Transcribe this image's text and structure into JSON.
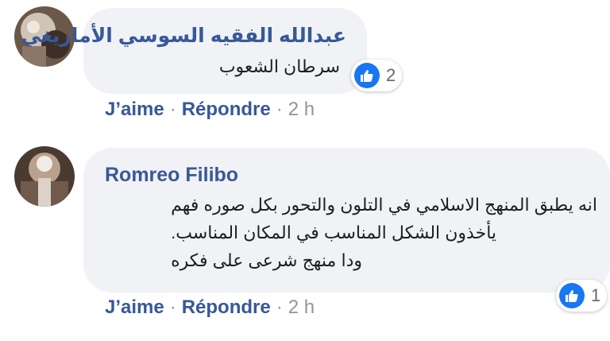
{
  "comments": [
    {
      "author": "عبدالله الفقيه السوسي الأمازيغي",
      "text_lines": [
        "سرطان الشعوب"
      ],
      "reaction_count": "2",
      "reaction_icon": "like-icon",
      "like_label": "J’aime",
      "reply_label": "Répondre",
      "separator": "·",
      "time": "2 h"
    },
    {
      "author": "Romreo Filibo",
      "text_lines": [
        "انه يطبق المنهج الاسلامي في التلون والتحور بكل صوره فهم",
        "يأخذون الشكل المناسب في المكان المناسب.",
        "ودا منهج شرعى على فكره"
      ],
      "reaction_count": "1",
      "reaction_icon": "like-icon",
      "like_label": "J’aime",
      "reply_label": "Répondre",
      "separator": "·",
      "time": "2 h"
    }
  ],
  "colors": {
    "author": "#385898",
    "bubble": "#f0f2f5",
    "like_blue": "#1877f2",
    "meta_gray": "#90949c"
  }
}
